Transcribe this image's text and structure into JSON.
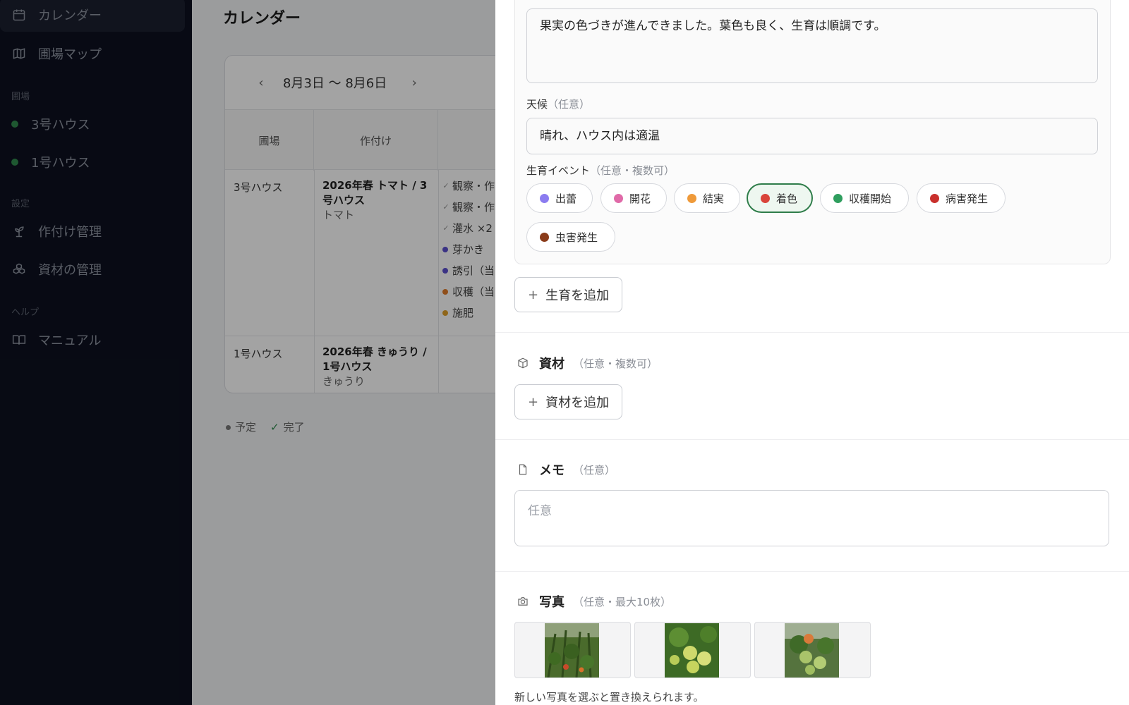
{
  "sidebar": {
    "items": [
      {
        "label": "カレンダー",
        "icon": "calendar-icon",
        "active": true
      },
      {
        "label": "圃場マップ",
        "icon": "map-icon"
      }
    ],
    "section_fields": "圃場",
    "fields": [
      {
        "label": "3号ハウス"
      },
      {
        "label": "1号ハウス"
      }
    ],
    "section_settings": "設定",
    "settings": [
      {
        "label": "作付け管理",
        "icon": "sprout-icon"
      },
      {
        "label": "資材の管理",
        "icon": "boxes-icon"
      }
    ],
    "section_help": "ヘルプ",
    "help": [
      {
        "label": "マニュアル",
        "icon": "book-icon"
      }
    ]
  },
  "calendar": {
    "title": "カレンダー",
    "range": "8月3日 〜 8月6日",
    "prev": "‹",
    "next": "›",
    "col_field": "圃場",
    "col_crop": "作付け",
    "rows": [
      {
        "field": "3号ハウス",
        "crop_title": "2026年春 トマト / 3号ハウス",
        "crop_sub": "トマト",
        "tasks": [
          {
            "label": "観察・作",
            "mark": "check"
          },
          {
            "label": "観察・作",
            "mark": "check"
          },
          {
            "label": "灌水 ×2",
            "mark": "check"
          },
          {
            "label": "芽かき",
            "mark": "dot",
            "color": "#5b4fcf"
          },
          {
            "label": "誘引（当",
            "mark": "dot",
            "color": "#5b4fcf"
          },
          {
            "label": "収穫（当",
            "mark": "dot",
            "color": "#e07b2a"
          },
          {
            "label": "施肥",
            "mark": "dot",
            "color": "#e0a02a"
          }
        ]
      },
      {
        "field": "1号ハウス",
        "crop_title": "2026年春 きゅうり / 1号ハウス",
        "crop_sub": "きゅうり",
        "tasks": []
      }
    ],
    "legend_planned": "予定",
    "legend_done": "完了"
  },
  "drawer": {
    "note_text": "果実の色づきが進んできました。葉色も良く、生育は順調です。",
    "weather_label": "天候",
    "weather_opt": "（任意）",
    "weather_value": "晴れ、ハウス内は適温",
    "events_label": "生育イベント",
    "events_opt": "（任意・複数可）",
    "events": [
      {
        "label": "出蕾",
        "color": "#8b7cf0"
      },
      {
        "label": "開花",
        "color": "#e06aa8"
      },
      {
        "label": "結実",
        "color": "#ef9a3a"
      },
      {
        "label": "着色",
        "color": "#d9443a",
        "selected": true
      },
      {
        "label": "収穫開始",
        "color": "#2f9e5e"
      },
      {
        "label": "病害発生",
        "color": "#c9302c"
      },
      {
        "label": "虫害発生",
        "color": "#8a3b1a"
      }
    ],
    "add_growth": "生育を追加",
    "materials_title": "資材",
    "materials_opt": "（任意・複数可）",
    "add_material": "資材を追加",
    "memo_title": "メモ",
    "memo_opt": "（任意）",
    "memo_placeholder": "任意",
    "photos_title": "写真",
    "photos_opt": "（任意・最大10枚）",
    "photos": [
      {
        "name": "tomato-plants-photo"
      },
      {
        "name": "green-tomatoes-photo"
      },
      {
        "name": "ripening-tomatoes-photo"
      }
    ],
    "photo_note": "新しい写真を選ぶと置き換えられます。"
  }
}
